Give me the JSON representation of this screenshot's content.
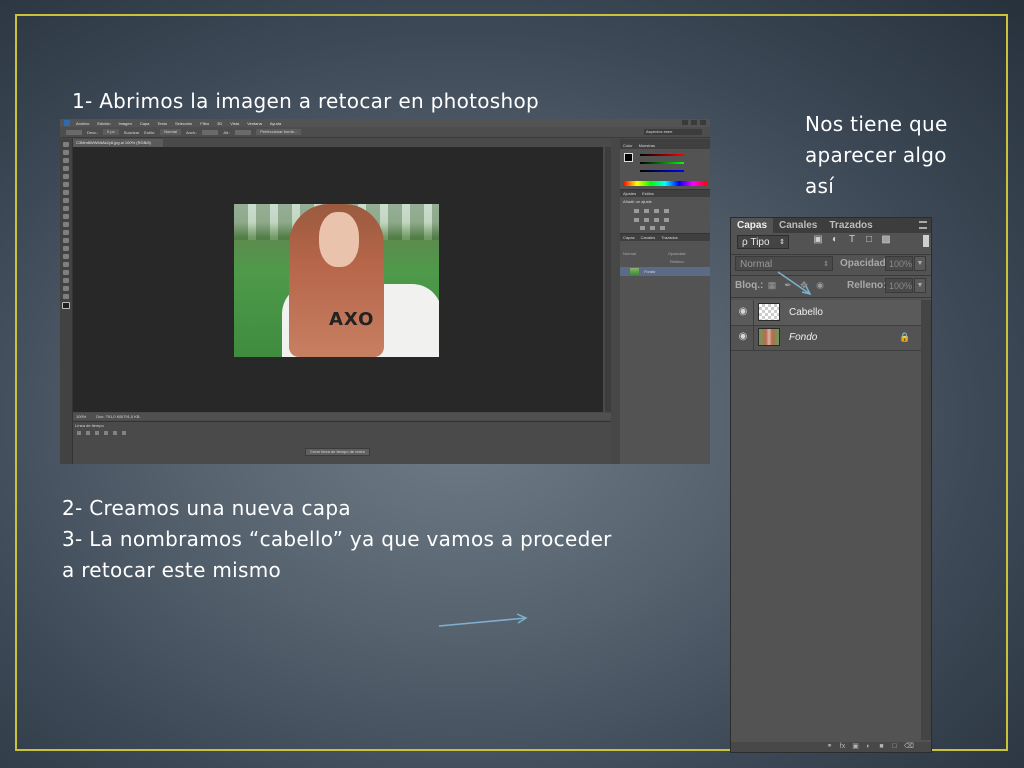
{
  "slide": {
    "step1": "1- Abrimos la imagen a retocar en photoshop",
    "note_lines": [
      "Nos tiene que",
      "aparecer algo",
      "así"
    ],
    "step2": "2- Creamos una nueva capa",
    "step3_line1": "3- La nombramos “cabello” ya que vamos a proceder",
    "step3_line2": "a retocar este mismo"
  },
  "colors": {
    "frame": "#c9c23a",
    "arrow": "#7fb0cc",
    "ps_bg": "#535353"
  },
  "photoshop": {
    "menu": [
      "Archivo",
      "Edición",
      "Imagen",
      "Capa",
      "Texto",
      "Selección",
      "Filtro",
      "3D",
      "Vista",
      "Ventana",
      "Ayuda"
    ],
    "options": {
      "desv": "Desv.:",
      "desv_val": "0 px",
      "suavizar": "Suavizar",
      "estilo": "Estilo:",
      "estilo_val": "Normal",
      "anch": "Anch.:",
      "alt": "Alt.:",
      "perfeccionar": "Perfeccionar borde..."
    },
    "workspace": "Aspectos esen.",
    "doc_tab": "C3Mm8WWMtAk2y8.jpg al 100% (RGB/8)",
    "status": {
      "zoom": "100%",
      "doc": "Doc: 791,0 KB/791,0 KB"
    },
    "timeline": {
      "title": "Línea de tiempo",
      "button": "Crear línea de tiempo de vídeo"
    },
    "color_panel": {
      "tabs": [
        "Color",
        "Muestras"
      ]
    },
    "adjust_panel": {
      "tabs": [
        "Ajustes",
        "Estilos"
      ],
      "title": "Añadir un ajuste"
    },
    "layers_panel": {
      "tabs": [
        "Capas",
        "Canales",
        "Trazados"
      ],
      "blend": "Normal",
      "opacity": "Opacidad:",
      "fill": "Relleno:",
      "layer": "Fondo"
    },
    "photo_text": "AXO"
  },
  "layers": {
    "tabs": [
      "Capas",
      "Canales",
      "Trazados"
    ],
    "filter": "ρ Tipo",
    "blend_mode": "Normal",
    "opacity_label": "Opacidad:",
    "opacity_value": "100%",
    "lock_label": "Bloq.:",
    "fill_label": "Relleno:",
    "fill_value": "100%",
    "items": [
      {
        "name": "Cabello",
        "thumbnail": "transparent",
        "visible": true
      },
      {
        "name": "Fondo",
        "thumbnail": "photo",
        "visible": true,
        "locked": true
      }
    ]
  }
}
